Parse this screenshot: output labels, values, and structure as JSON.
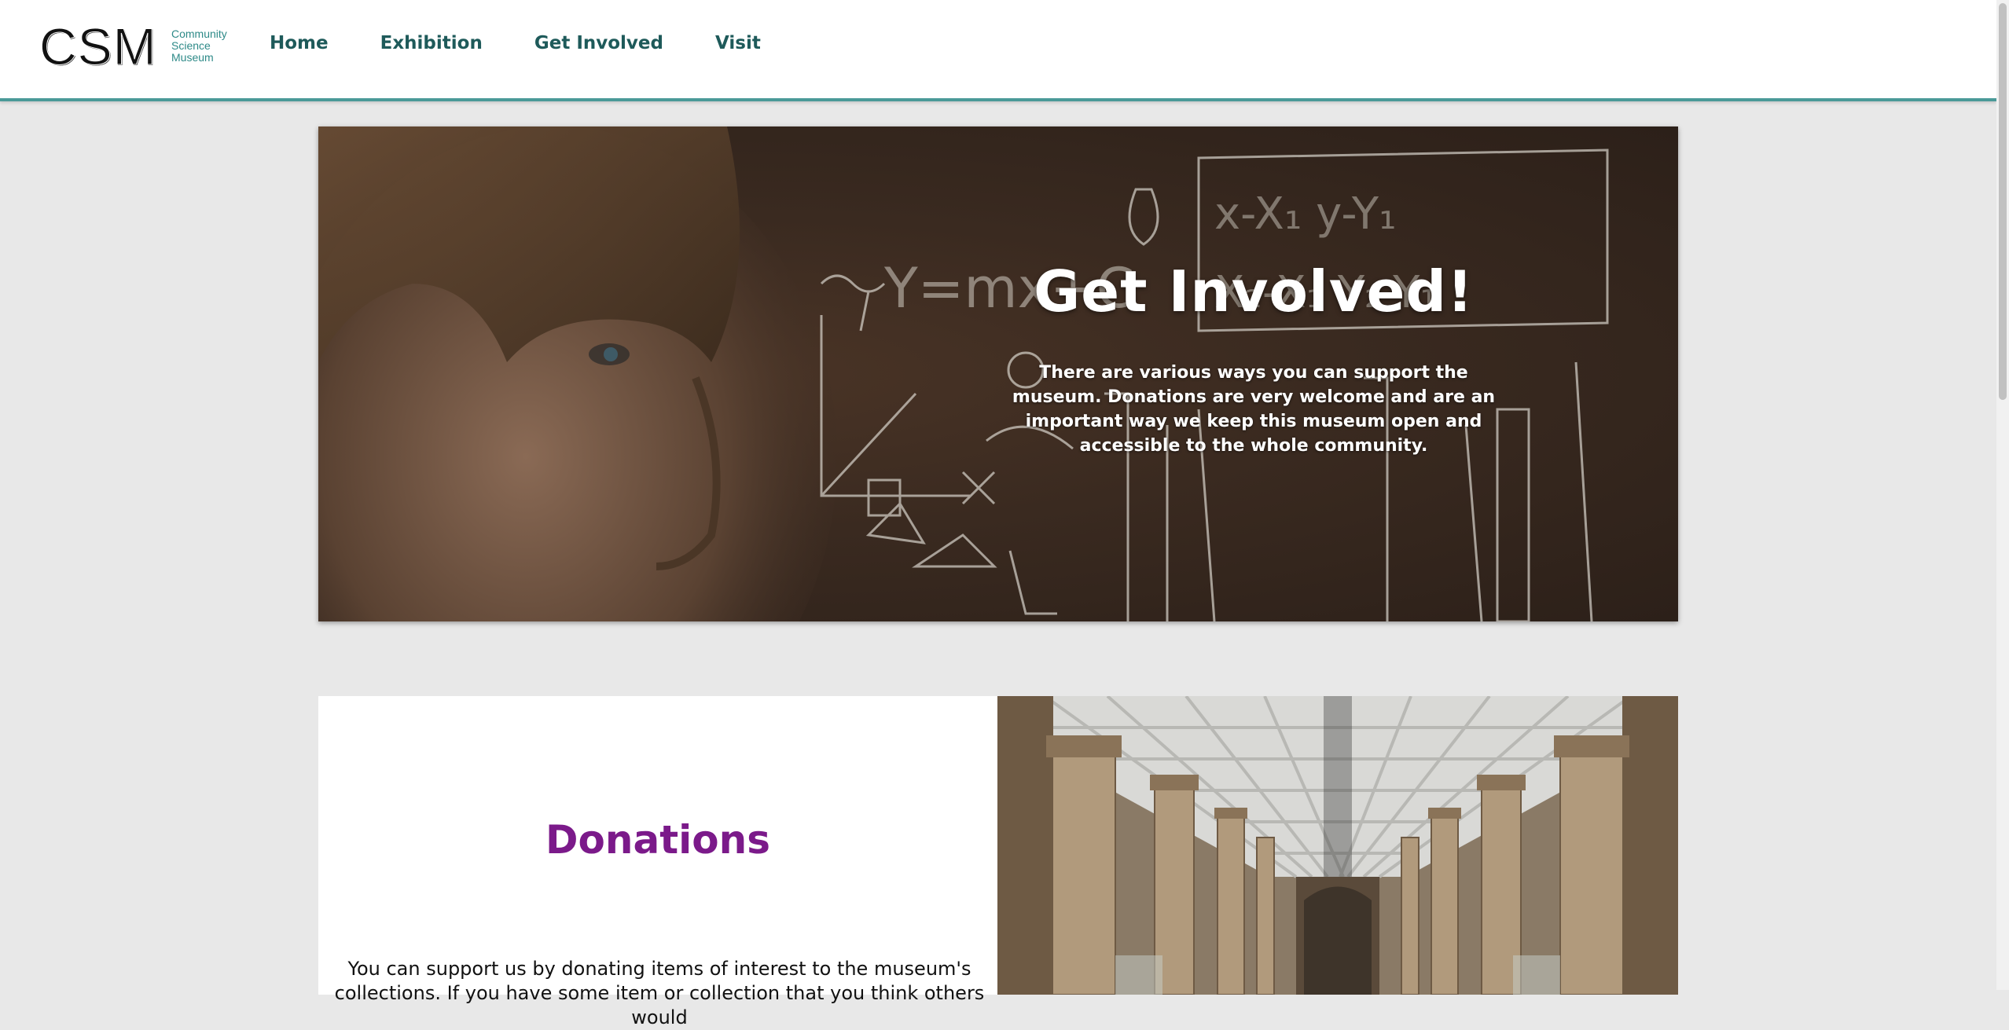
{
  "header": {
    "logo": {
      "mark": "CSM",
      "lines": [
        "Community",
        "Science",
        "Museum"
      ]
    },
    "nav": [
      "Home",
      "Exhibition",
      "Get Involved",
      "Visit"
    ]
  },
  "hero": {
    "title": "Get Involved!",
    "text": "There are various ways you can support the museum. Donations are very welcome and are an important way we keep this museum open and accessible to the whole community.",
    "image": "child-chalkboard-photo"
  },
  "donations": {
    "title": "Donations",
    "text": "You can support us by donating items of interest to the museum's collections. If you have some item or collection that you think others would",
    "image": "museum-hall-photo"
  },
  "colors": {
    "accent": "#4a9a98",
    "nav": "#1e5a5a",
    "donations_title": "#7b1a8a",
    "page_bg": "#e8e8e8"
  }
}
